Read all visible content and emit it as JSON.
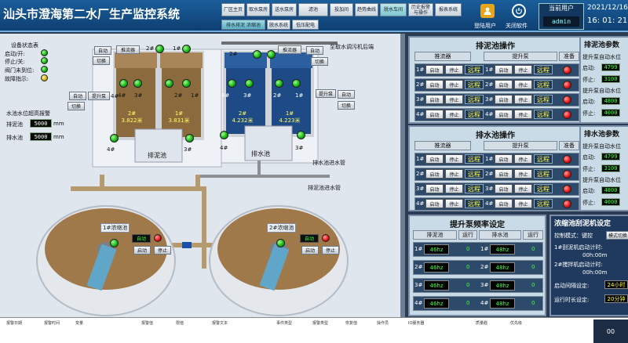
{
  "header": {
    "title": "汕头市澄海第二水厂生产监控系统",
    "nav": [
      {
        "label": "厂区主页"
      },
      {
        "label": "取水泵房"
      },
      {
        "label": "送水泵房"
      },
      {
        "label": "滤池"
      },
      {
        "label": "投加间"
      },
      {
        "label": "趋势曲线"
      },
      {
        "label": "脱水车间"
      },
      {
        "label": "历史报警\n与操作"
      },
      {
        "label": "报表系统"
      }
    ],
    "sub_nav": [
      {
        "label": "排水排泥 浓缩池"
      },
      {
        "label": "脱水系统"
      },
      {
        "label": "低压配电"
      }
    ],
    "login_label": "登陆用户",
    "close_label": "关闭软件",
    "current_user_label": "当前用户",
    "current_user": "admin",
    "date": "2021/12/16",
    "time": "16: 01: 21"
  },
  "legend": {
    "title": "设备状态表",
    "items": [
      {
        "label": "启动/开:",
        "color": "#14c014"
      },
      {
        "label": "停止/关:",
        "color": "#14c014"
      },
      {
        "label": "阀门未到位:",
        "color": "#14c014"
      },
      {
        "label": "故障指示:",
        "color": "#d8b40a"
      }
    ]
  },
  "alarm": {
    "title": "水池水位超高报警",
    "mud_label": "排泥池",
    "mud_value": "5000",
    "drain_label": "排水池",
    "drain_value": "5000",
    "unit": "mm"
  },
  "plant": {
    "auto": "自动",
    "switch": "切换",
    "pusher": "推流器",
    "lift_pump": "提升泵",
    "mud_pool": "排泥池",
    "drain_pool": "排水池",
    "to_intake": "至取水调污机后端",
    "drain_inlet": "排水池进水管",
    "mud_inlet": "排泥池进水管",
    "p1": "1#",
    "p2": "2#",
    "p3": "3#",
    "p4": "4#",
    "mud_2_level": "2#\n3.822米",
    "mud_1_level": "1#\n3.831米",
    "drain_2_level": "2#\n4.232米",
    "drain_1_level": "1#\n4.223米",
    "thick_1": "1#浓缩池",
    "thick_2": "2#浓缩池",
    "start": "启动",
    "stop": "停止"
  },
  "mud_ops": {
    "title": "排泥池操作",
    "col_pusher": "推流器",
    "col_lift": "提升泵",
    "col_ready": "准备",
    "rows": [
      "1#",
      "2#",
      "3#",
      "4#"
    ],
    "start": "启动",
    "stop": "停止",
    "remote": "远程"
  },
  "drain_ops": {
    "title": "排水池操作",
    "col_pusher": "推流器",
    "col_lift": "提升泵",
    "col_ready": "准备",
    "rows": [
      "1#",
      "2#",
      "3#",
      "4#"
    ],
    "start": "启动",
    "stop": "停止",
    "remote": "远程"
  },
  "mud_params": {
    "title": "排泥池参数",
    "auto_label": "提升泵自动水位",
    "rows": [
      {
        "label": "启动:",
        "value": "4799"
      },
      {
        "label": "停止:",
        "value": "3100"
      },
      {
        "label": "启动:",
        "value": "4800"
      },
      {
        "label": "停止:",
        "value": "4000"
      }
    ]
  },
  "drain_params": {
    "title": "排水池参数",
    "auto_label": "提升泵自动水位",
    "rows": [
      {
        "label": "启动:",
        "value": "4799"
      },
      {
        "label": "停止:",
        "value": "3100"
      },
      {
        "label": "启动:",
        "value": "4800"
      },
      {
        "label": "停止:",
        "value": "4000"
      }
    ]
  },
  "freq": {
    "title": "提升泵频率设定",
    "col_mud": "排泥池",
    "col_run": "运行",
    "col_drain": "排水池",
    "rows": [
      {
        "id": "1#",
        "mud_hz": "46hz",
        "mud_run": "0",
        "drain_id": "1#",
        "drain_hz": "48hz",
        "drain_run": "0"
      },
      {
        "id": "2#",
        "mud_hz": "46hz",
        "mud_run": "0",
        "drain_id": "2#",
        "drain_hz": "48hz",
        "drain_run": "0"
      },
      {
        "id": "3#",
        "mud_hz": "46hz",
        "mud_run": "0",
        "drain_id": "3#",
        "drain_hz": "48hz",
        "drain_run": "0"
      },
      {
        "id": "4#",
        "mud_hz": "46hz",
        "mud_run": "0",
        "drain_id": "4#",
        "drain_hz": "48hz",
        "drain_run": "0"
      }
    ]
  },
  "thickener": {
    "title": "浓缩池刮泥机设定",
    "mode_label": "控制模式：键控",
    "mode_btn": "模式切换",
    "t1_label": "1#刮泥机启动计时:",
    "t1_value": "00h:00m",
    "t2_label": "2#搅拌机启动计时:",
    "t2_value": "00h:00m",
    "interval_label": "启动间隔设定:",
    "interval_value": "24小时",
    "run_label": "运行时长设定:",
    "run_value": "20分钟"
  },
  "alarm_table": {
    "headers": [
      "报警日期",
      "报警时间",
      "变量",
      "报警值",
      "限值",
      "报警文本",
      "事件类型",
      "报警类型",
      "恢复值",
      "操作员",
      "IO服务器",
      "质量戳",
      "优先级"
    ],
    "side_value": "00"
  }
}
